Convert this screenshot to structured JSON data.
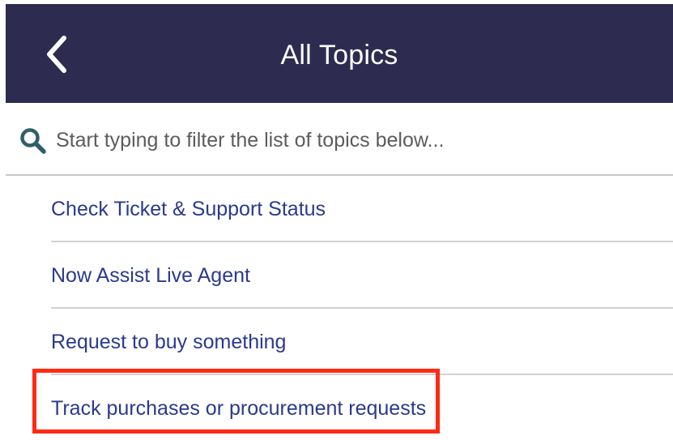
{
  "header": {
    "title": "All Topics",
    "back_icon": "chevron-left-icon",
    "background_color": "#2d2b4f"
  },
  "search": {
    "icon": "search-icon",
    "placeholder": "Start typing to filter the list of topics below...",
    "value": ""
  },
  "topics": [
    {
      "label": "Check Ticket & Support Status"
    },
    {
      "label": "Now Assist Live Agent"
    },
    {
      "label": "Request to buy something"
    },
    {
      "label": "Track purchases or procurement requests"
    }
  ],
  "colors": {
    "link": "#2b3a8c",
    "highlight": "#ff2a14",
    "search_icon": "#2f5f6a"
  }
}
